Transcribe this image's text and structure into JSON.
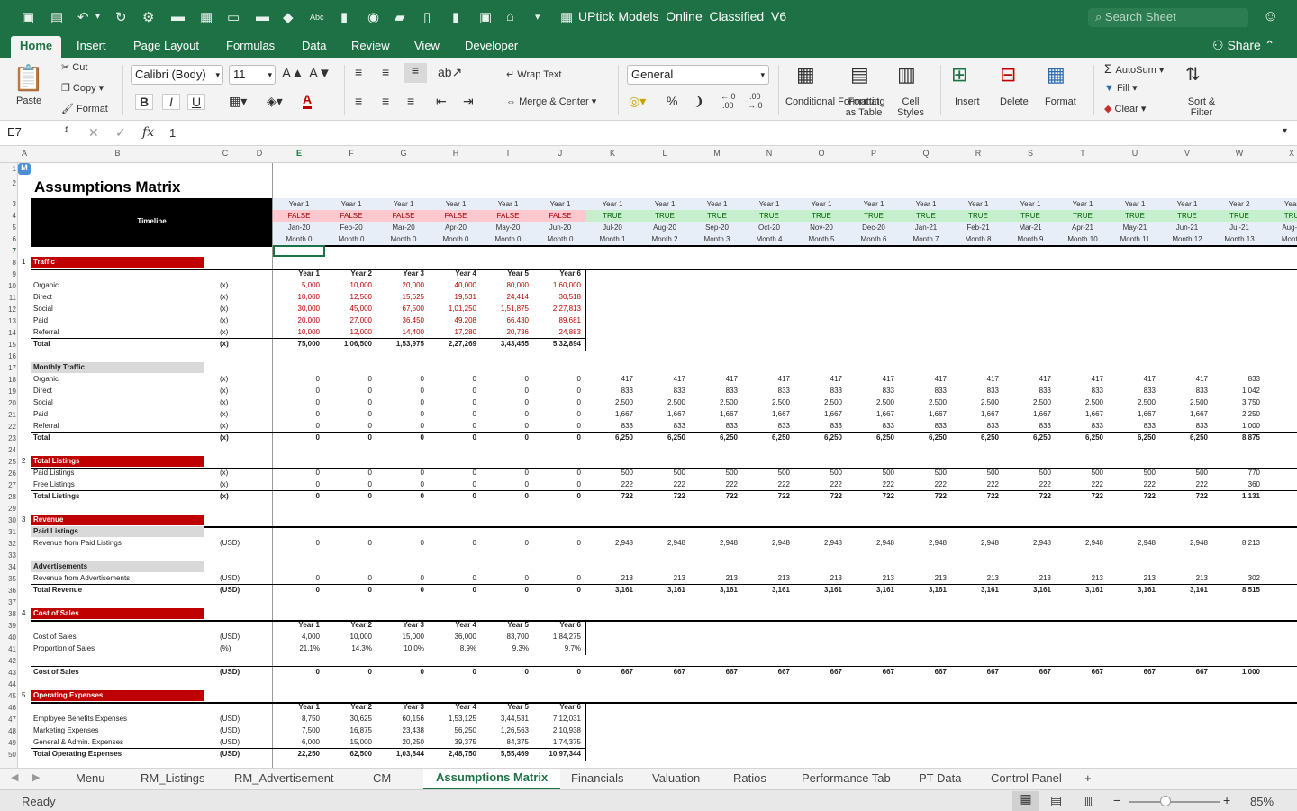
{
  "app": {
    "title": "UPtick Models_Online_Classified_V6",
    "search_placeholder": "Search Sheet",
    "share_label": "Share"
  },
  "ribbon_tabs": [
    "Home",
    "Insert",
    "Page Layout",
    "Formulas",
    "Data",
    "Review",
    "View",
    "Developer"
  ],
  "ribbon": {
    "paste": "Paste",
    "cut": "Cut",
    "copy": "Copy",
    "format": "Format",
    "font_name": "Calibri (Body)",
    "font_size": "11",
    "wrap_text": "Wrap Text",
    "merge_center": "Merge & Center",
    "number_format": "General",
    "conditional_formatting": "Conditional Formatting",
    "format_as_table": "Format as Table",
    "cell_styles": "Cell Styles",
    "insert": "Insert",
    "delete": "Delete",
    "format_cells": "Format",
    "autosum": "AutoSum",
    "fill": "Fill",
    "clear": "Clear",
    "sort_filter": "Sort & Filter",
    "bold": "B",
    "italic": "I",
    "underline": "U",
    "increase_font": "A",
    "decrease_font": "A",
    "font_color": "A"
  },
  "formula_bar": {
    "name_box": "E7",
    "fx": "fx",
    "value": "1"
  },
  "columns": [
    "A",
    "B",
    "C",
    "D",
    "E",
    "F",
    "G",
    "H",
    "I",
    "J",
    "K",
    "L",
    "M",
    "N",
    "O",
    "P",
    "Q",
    "R",
    "S",
    "T",
    "U",
    "V",
    "W",
    "X"
  ],
  "sheet_title": "Assumptions Matrix",
  "timeline_label": "Timeline",
  "timeline": {
    "years": [
      "Year 1",
      "Year 1",
      "Year 1",
      "Year 1",
      "Year 1",
      "Year 1",
      "Year 1",
      "Year 1",
      "Year 1",
      "Year 1",
      "Year 1",
      "Year 1",
      "Year 1",
      "Year 1",
      "Year 1",
      "Year 1",
      "Year 1",
      "Year 1",
      "Year 2",
      "Year"
    ],
    "flags": [
      "FALSE",
      "FALSE",
      "FALSE",
      "FALSE",
      "FALSE",
      "FALSE",
      "TRUE",
      "TRUE",
      "TRUE",
      "TRUE",
      "TRUE",
      "TRUE",
      "TRUE",
      "TRUE",
      "TRUE",
      "TRUE",
      "TRUE",
      "TRUE",
      "TRUE",
      "TRU"
    ],
    "months": [
      "Jan-20",
      "Feb-20",
      "Mar-20",
      "Apr-20",
      "May-20",
      "Jun-20",
      "Jul-20",
      "Aug-20",
      "Sep-20",
      "Oct-20",
      "Nov-20",
      "Dec-20",
      "Jan-21",
      "Feb-21",
      "Mar-21",
      "Apr-21",
      "May-21",
      "Jun-21",
      "Jul-21",
      "Aug-2"
    ],
    "month_nums": [
      "Month 0",
      "Month 0",
      "Month 0",
      "Month 0",
      "Month 0",
      "Month 0",
      "Month 1",
      "Month 2",
      "Month 3",
      "Month 4",
      "Month 5",
      "Month 6",
      "Month 7",
      "Month 8",
      "Month 9",
      "Month 10",
      "Month 11",
      "Month 12",
      "Month 13",
      "Month"
    ]
  },
  "year_headers": [
    "Year 1",
    "Year 2",
    "Year 3",
    "Year 4",
    "Year 5",
    "Year 6"
  ],
  "sections": [
    {
      "row": 8,
      "num": "1",
      "label": "Traffic"
    },
    {
      "row": 25,
      "num": "2",
      "label": "Total Listings"
    },
    {
      "row": 30,
      "num": "3",
      "label": "Revenue"
    },
    {
      "row": 38,
      "num": "4",
      "label": "Cost of Sales"
    },
    {
      "row": 45,
      "num": "5",
      "label": "Operating Expenses"
    }
  ],
  "subsections": [
    {
      "row": 17,
      "label": "Monthly Traffic"
    },
    {
      "row": 31,
      "label": "Paid Listings"
    },
    {
      "row": 34,
      "label": "Advertisements"
    }
  ],
  "rows": [
    {
      "row": 10,
      "label": "Organic",
      "unit": "(x)",
      "red": true,
      "vals": [
        "5,000",
        "10,000",
        "20,000",
        "40,000",
        "80,000",
        "1,60,000"
      ]
    },
    {
      "row": 11,
      "label": "Direct",
      "unit": "(x)",
      "red": true,
      "vals": [
        "10,000",
        "12,500",
        "15,625",
        "19,531",
        "24,414",
        "30,518"
      ]
    },
    {
      "row": 12,
      "label": "Social",
      "unit": "(x)",
      "red": true,
      "vals": [
        "30,000",
        "45,000",
        "67,500",
        "1,01,250",
        "1,51,875",
        "2,27,813"
      ]
    },
    {
      "row": 13,
      "label": "Paid",
      "unit": "(x)",
      "red": true,
      "vals": [
        "20,000",
        "27,000",
        "36,450",
        "49,208",
        "66,430",
        "89,681"
      ]
    },
    {
      "row": 14,
      "label": "Referral",
      "unit": "(x)",
      "red": true,
      "vals": [
        "10,000",
        "12,000",
        "14,400",
        "17,280",
        "20,736",
        "24,883"
      ]
    },
    {
      "row": 15,
      "label": "Total",
      "unit": "(x)",
      "bold": true,
      "vals": [
        "75,000",
        "1,06,500",
        "1,53,975",
        "2,27,269",
        "3,43,455",
        "5,32,894"
      ]
    },
    {
      "row": 18,
      "label": "Organic",
      "unit": "(x)",
      "vals": [
        "0",
        "0",
        "0",
        "0",
        "0",
        "0",
        "417",
        "417",
        "417",
        "417",
        "417",
        "417",
        "417",
        "417",
        "417",
        "417",
        "417",
        "417",
        "833"
      ]
    },
    {
      "row": 19,
      "label": "Direct",
      "unit": "(x)",
      "vals": [
        "0",
        "0",
        "0",
        "0",
        "0",
        "0",
        "833",
        "833",
        "833",
        "833",
        "833",
        "833",
        "833",
        "833",
        "833",
        "833",
        "833",
        "833",
        "1,042"
      ]
    },
    {
      "row": 20,
      "label": "Social",
      "unit": "(x)",
      "vals": [
        "0",
        "0",
        "0",
        "0",
        "0",
        "0",
        "2,500",
        "2,500",
        "2,500",
        "2,500",
        "2,500",
        "2,500",
        "2,500",
        "2,500",
        "2,500",
        "2,500",
        "2,500",
        "2,500",
        "3,750"
      ]
    },
    {
      "row": 21,
      "label": "Paid",
      "unit": "(x)",
      "vals": [
        "0",
        "0",
        "0",
        "0",
        "0",
        "0",
        "1,667",
        "1,667",
        "1,667",
        "1,667",
        "1,667",
        "1,667",
        "1,667",
        "1,667",
        "1,667",
        "1,667",
        "1,667",
        "1,667",
        "2,250"
      ]
    },
    {
      "row": 22,
      "label": "Referral",
      "unit": "(x)",
      "vals": [
        "0",
        "0",
        "0",
        "0",
        "0",
        "0",
        "833",
        "833",
        "833",
        "833",
        "833",
        "833",
        "833",
        "833",
        "833",
        "833",
        "833",
        "833",
        "1,000"
      ]
    },
    {
      "row": 23,
      "label": "Total",
      "unit": "(x)",
      "bold": true,
      "vals": [
        "0",
        "0",
        "0",
        "0",
        "0",
        "0",
        "6,250",
        "6,250",
        "6,250",
        "6,250",
        "6,250",
        "6,250",
        "6,250",
        "6,250",
        "6,250",
        "6,250",
        "6,250",
        "6,250",
        "8,875"
      ]
    },
    {
      "row": 26,
      "label": "Paid Listings",
      "unit": "(x)",
      "vals": [
        "0",
        "0",
        "0",
        "0",
        "0",
        "0",
        "500",
        "500",
        "500",
        "500",
        "500",
        "500",
        "500",
        "500",
        "500",
        "500",
        "500",
        "500",
        "770"
      ]
    },
    {
      "row": 27,
      "label": "Free Listings",
      "unit": "(x)",
      "vals": [
        "0",
        "0",
        "0",
        "0",
        "0",
        "0",
        "222",
        "222",
        "222",
        "222",
        "222",
        "222",
        "222",
        "222",
        "222",
        "222",
        "222",
        "222",
        "360"
      ]
    },
    {
      "row": 28,
      "label": "Total Listings",
      "unit": "(x)",
      "bold": true,
      "vals": [
        "0",
        "0",
        "0",
        "0",
        "0",
        "0",
        "722",
        "722",
        "722",
        "722",
        "722",
        "722",
        "722",
        "722",
        "722",
        "722",
        "722",
        "722",
        "1,131"
      ]
    },
    {
      "row": 32,
      "label": "Revenue from Paid Listings",
      "unit": "(USD)",
      "vals": [
        "0",
        "0",
        "0",
        "0",
        "0",
        "0",
        "2,948",
        "2,948",
        "2,948",
        "2,948",
        "2,948",
        "2,948",
        "2,948",
        "2,948",
        "2,948",
        "2,948",
        "2,948",
        "2,948",
        "8,213"
      ]
    },
    {
      "row": 35,
      "label": "Revenue from Advertisements",
      "unit": "(USD)",
      "vals": [
        "0",
        "0",
        "0",
        "0",
        "0",
        "0",
        "213",
        "213",
        "213",
        "213",
        "213",
        "213",
        "213",
        "213",
        "213",
        "213",
        "213",
        "213",
        "302"
      ]
    },
    {
      "row": 36,
      "label": "Total Revenue",
      "unit": "(USD)",
      "bold": true,
      "vals": [
        "0",
        "0",
        "0",
        "0",
        "0",
        "0",
        "3,161",
        "3,161",
        "3,161",
        "3,161",
        "3,161",
        "3,161",
        "3,161",
        "3,161",
        "3,161",
        "3,161",
        "3,161",
        "3,161",
        "8,515"
      ]
    },
    {
      "row": 40,
      "label": "Cost of Sales",
      "unit": "(USD)",
      "vals": [
        "4,000",
        "10,000",
        "15,000",
        "36,000",
        "83,700",
        "1,84,275"
      ]
    },
    {
      "row": 41,
      "label": "Proportion of Sales",
      "unit": "(%)",
      "vals": [
        "21.1%",
        "14.3%",
        "10.0%",
        "8.9%",
        "9.3%",
        "9.7%"
      ]
    },
    {
      "row": 43,
      "label": "Cost of Sales",
      "unit": "(USD)",
      "bold": true,
      "vals": [
        "0",
        "0",
        "0",
        "0",
        "0",
        "0",
        "667",
        "667",
        "667",
        "667",
        "667",
        "667",
        "667",
        "667",
        "667",
        "667",
        "667",
        "667",
        "1,000"
      ]
    },
    {
      "row": 47,
      "label": "Employee Benefits Expenses",
      "unit": "(USD)",
      "vals": [
        "8,750",
        "30,625",
        "60,156",
        "1,53,125",
        "3,44,531",
        "7,12,031"
      ]
    },
    {
      "row": 48,
      "label": "Marketing Expenses",
      "unit": "(USD)",
      "vals": [
        "7,500",
        "16,875",
        "23,438",
        "56,250",
        "1,26,563",
        "2,10,938"
      ]
    },
    {
      "row": 49,
      "label": "General & Admin. Expenses",
      "unit": "(USD)",
      "vals": [
        "6,000",
        "15,000",
        "20,250",
        "39,375",
        "84,375",
        "1,74,375"
      ]
    },
    {
      "row": 50,
      "label": "Total Operating Expenses",
      "unit": "(USD)",
      "bold": true,
      "vals": [
        "22,250",
        "62,500",
        "1,03,844",
        "2,48,750",
        "5,55,469",
        "10,97,344"
      ]
    }
  ],
  "year_header_rows": [
    9,
    39,
    46
  ],
  "sheet_tabs": [
    "Menu",
    "RM_Listings",
    "RM_Advertisement",
    "CM",
    "Assumptions Matrix",
    "Financials",
    "Valuation",
    "Ratios",
    "Performance Tab",
    "PT Data",
    "Control Panel",
    "+"
  ],
  "active_sheet": "Assumptions Matrix",
  "status": {
    "ready": "Ready",
    "zoom": "85%"
  }
}
